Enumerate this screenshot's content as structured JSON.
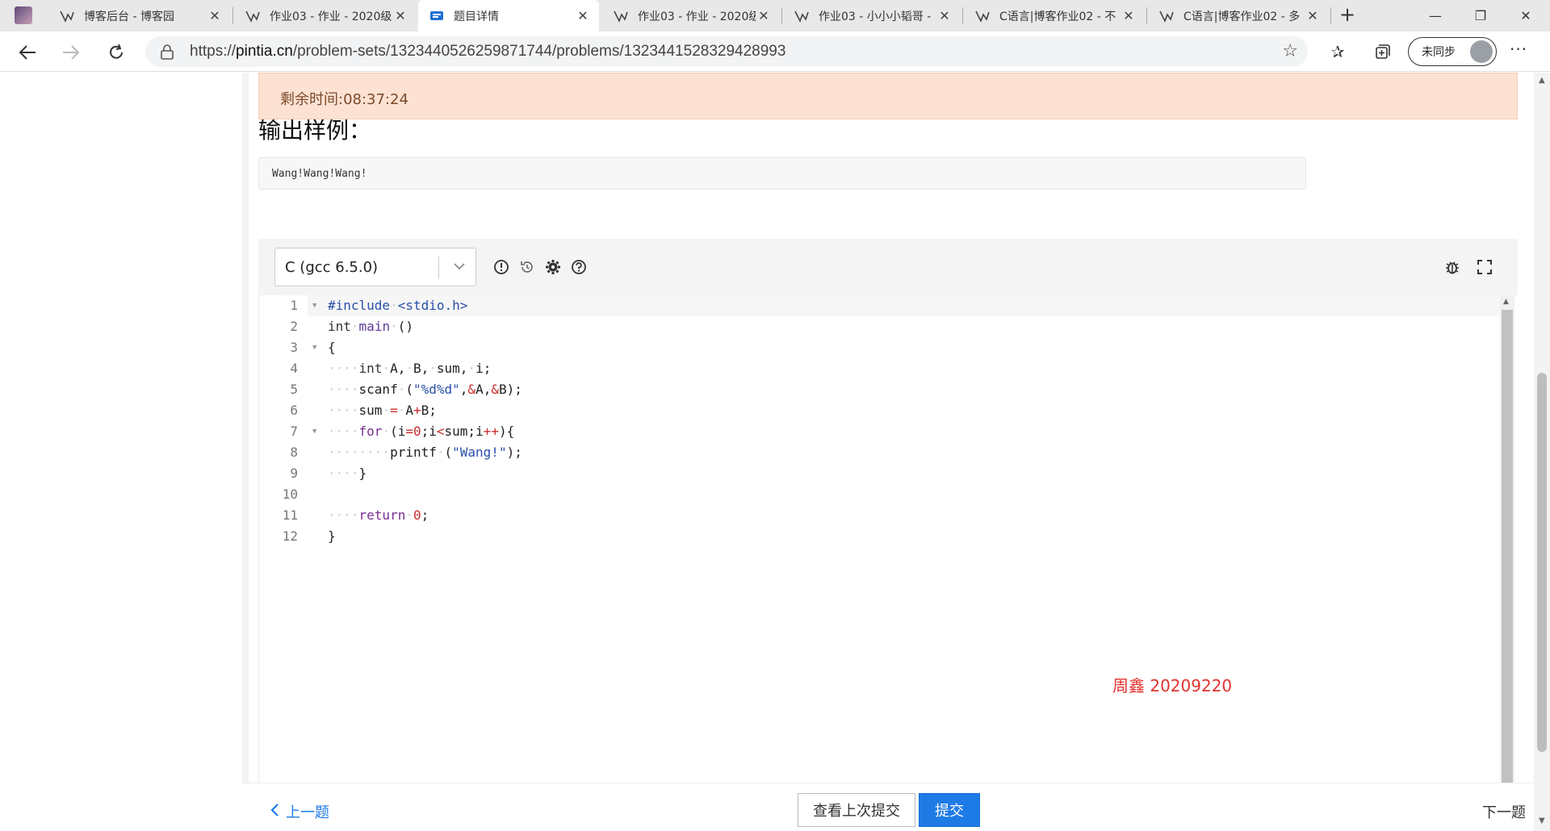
{
  "browser": {
    "tabs": [
      {
        "title": "博客后台 - 博客园"
      },
      {
        "title": "作业03 - 作业 - 2020级"
      },
      {
        "title": "题目详情"
      },
      {
        "title": "作业03 - 作业 - 2020级"
      },
      {
        "title": "作业03 - 小小小韬哥 -"
      },
      {
        "title": "C语言|博客作业02 - 不"
      },
      {
        "title": "C语言|博客作业02 - 多"
      }
    ],
    "url_prefix": "https://",
    "url_host": "pintia.cn",
    "url_path": "/problem-sets/1323440526259871744/problems/1323441528329428993",
    "sync_label": "未同步"
  },
  "problem": {
    "timer_text": "剩余时间:08:37:24",
    "output_heading": "输出样例：",
    "sample_output": "Wang!Wang!Wang!"
  },
  "editor": {
    "language": "C (gcc 6.5.0)",
    "watermark": "周鑫 20209220"
  },
  "footer": {
    "prev_label": "上一题",
    "view_last_label": "查看上次提交",
    "submit_label": "提交",
    "next_label": "下一题"
  },
  "colors": {
    "accent": "#1e7be6",
    "timer_bg": "#fde2d3",
    "watermark": "#e0322e"
  }
}
